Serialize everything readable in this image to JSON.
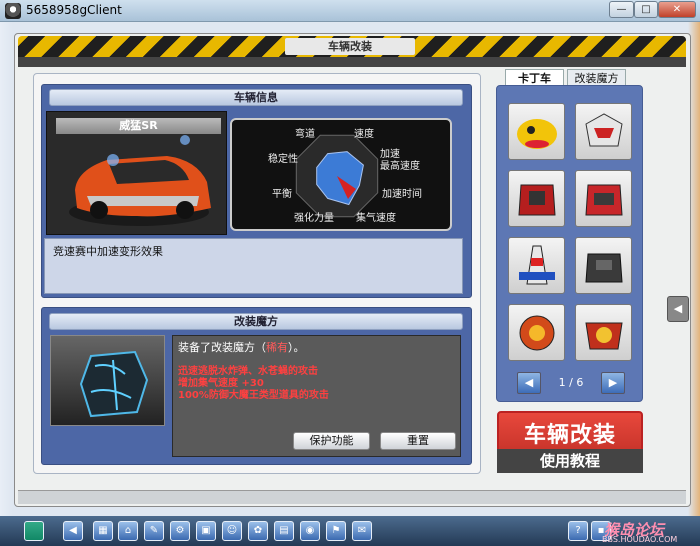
{
  "window": {
    "title": "5658958gClient",
    "min": "—",
    "max": "□",
    "close": "✕"
  },
  "hazard_title": "车辆改装",
  "vehicle_info": {
    "header": "车辆信息",
    "car_name": "威猛SR",
    "stats": {
      "wandao": "弯道",
      "sudu": "速度",
      "wendingxing": "稳定性",
      "jiasu": "加速",
      "zuigao": "最高速度",
      "pingheng": "平衡",
      "jiasushijian": "加速时间",
      "qianghua": "强化力量",
      "jiqi": "集气速度"
    },
    "description": "竞速赛中加速变形效果"
  },
  "modify_magic": {
    "header": "改装魔方",
    "equipped_prefix": "装备了改装魔方（",
    "equipped_name": "稀有",
    "equipped_suffix": "）。",
    "effects": [
      "迅速逃脱水炸弹、水苍蝇的攻击",
      "增加集气速度 +30",
      "100%防御大魔王类型道具的攻击"
    ],
    "protect_btn": "保护功能",
    "reset_btn": "重置"
  },
  "tabs": {
    "karting": "卡丁车",
    "magic": "改装魔方"
  },
  "pager": {
    "current": 1,
    "total": 6,
    "label": "1 / 6",
    "prev": "◀",
    "next": "▶"
  },
  "tutorial": {
    "title": "车辆改装",
    "subtitle": "使用教程"
  },
  "watermark": {
    "text": "猴岛论坛",
    "url": "BBS.HOUDAO.COM"
  },
  "radar_fraction": {
    "wandao": 0.55,
    "sudu": 0.6,
    "jiasu": 0.65,
    "jiasushijian": 0.55,
    "jiqi": 0.7,
    "qianghua": 0.55,
    "pingheng": 0.5,
    "wendingxing": 0.5
  },
  "colors": {
    "accent_blue": "#4d67a6",
    "hazard_yellow": "#e8b800",
    "effect_red": "#ff4040",
    "tutorial_red": "#c73328",
    "radar_fill": "#3c7bd6",
    "radar_red": "#d52222"
  }
}
